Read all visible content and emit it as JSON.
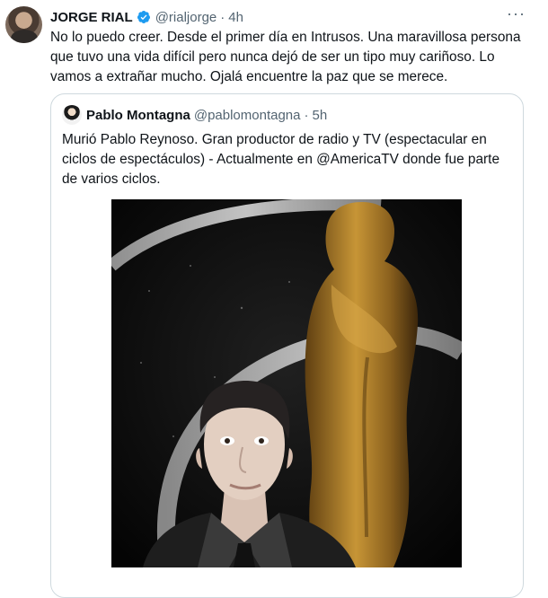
{
  "tweet": {
    "author_name": "JORGE RIAL",
    "handle": "@rialjorge",
    "separator": "·",
    "time": "4h",
    "more": "···",
    "text": "No lo puedo creer. Desde el primer día en Intrusos. Una maravillosa persona\nque tuvo una vida difícil pero nunca dejó de ser un tipo muy cariñoso. Lo\nvamos a extrañar mucho. Ojalá encuentre la paz que se merece."
  },
  "quote": {
    "author_name": "Pablo Montagna",
    "handle": "@pablomontagna",
    "separator": "·",
    "time": "5h",
    "text": "Murió Pablo Reynoso. Gran productor de radio y TV (espectacular en ciclos de espectáculos) - Actualmente en @AmericaTV donde fue parte de varios ciclos."
  },
  "colors": {
    "verified": "#1d9bf0",
    "secondary_text": "#536471",
    "border": "#cfd9de",
    "statue_gold": "#b8862b"
  },
  "icons": {
    "verified": "verified-badge-icon",
    "more": "more-horizontal-icon"
  }
}
